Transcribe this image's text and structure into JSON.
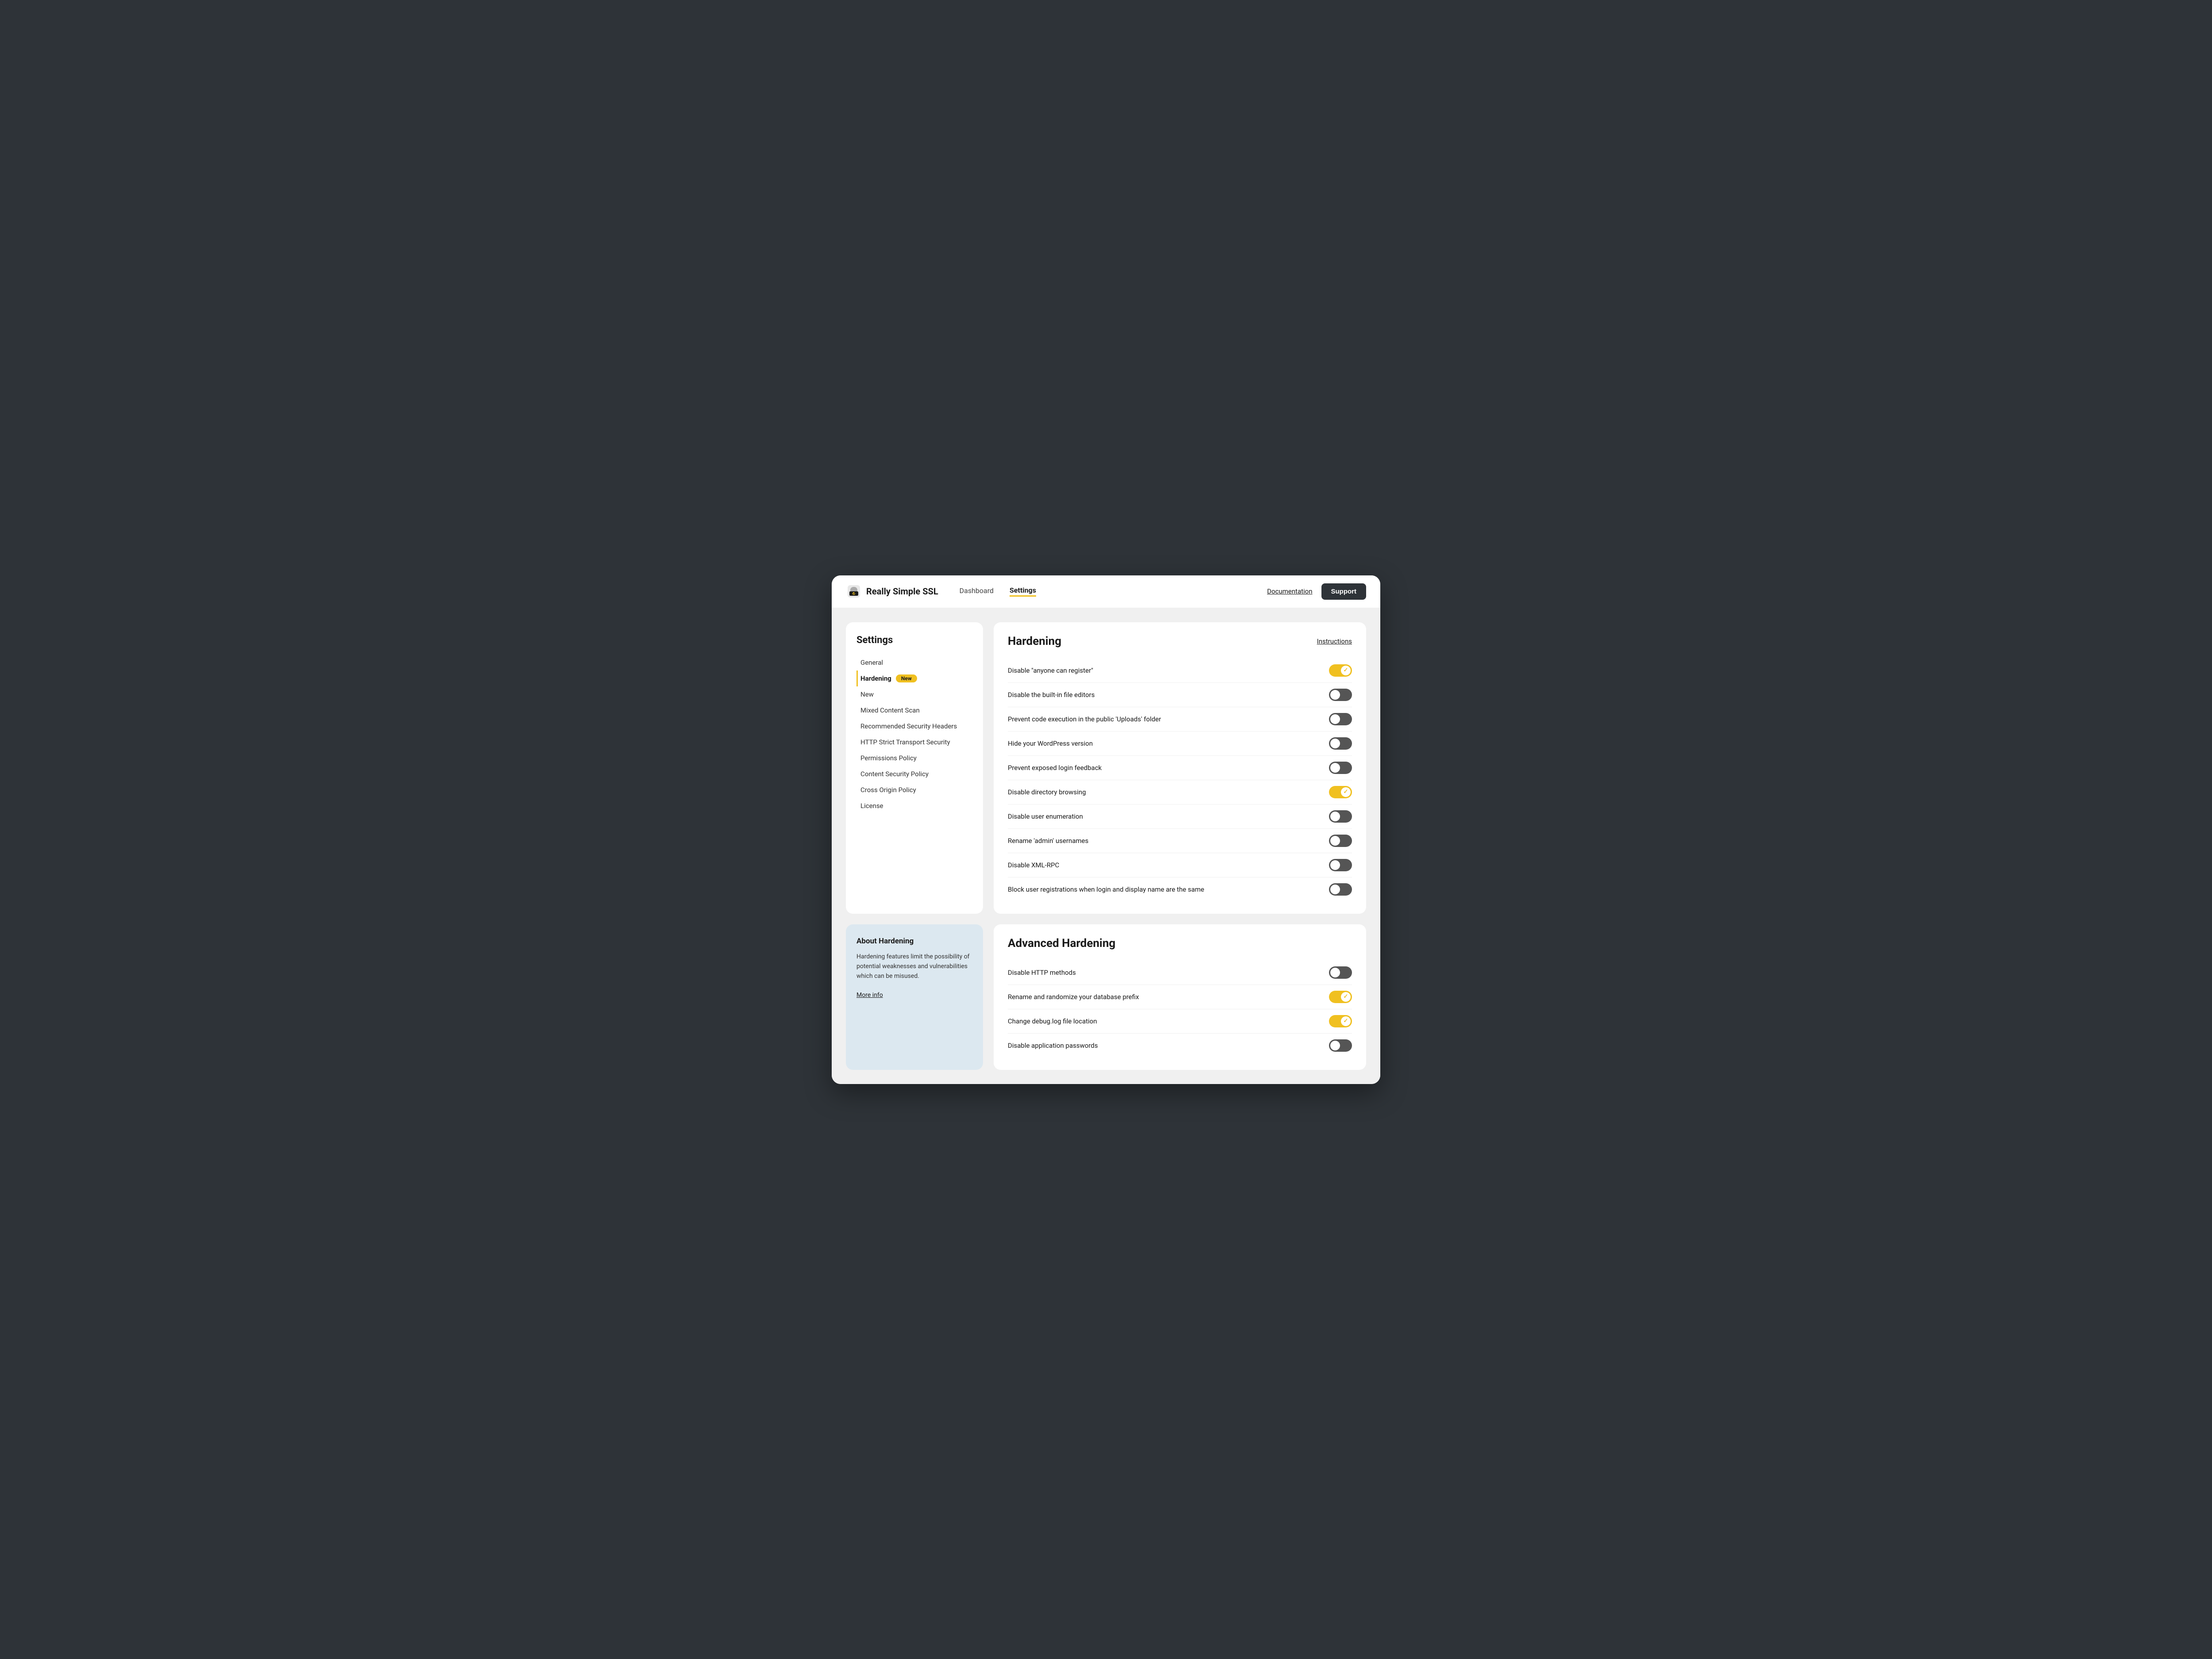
{
  "header": {
    "logo_text": "Really Simple SSL",
    "nav": [
      {
        "label": "Dashboard",
        "active": false
      },
      {
        "label": "Settings",
        "active": true
      }
    ],
    "documentation_label": "Documentation",
    "support_label": "Support"
  },
  "sidebar": {
    "title": "Settings",
    "menu_items": [
      {
        "label": "General",
        "active": false,
        "badge": null
      },
      {
        "label": "Hardening",
        "active": true,
        "badge": "New"
      },
      {
        "label": "New",
        "active": false,
        "badge": null
      },
      {
        "label": "Mixed Content Scan",
        "active": false,
        "badge": null
      },
      {
        "label": "Recommended Security Headers",
        "active": false,
        "badge": null
      },
      {
        "label": "HTTP Strict Transport Security",
        "active": false,
        "badge": null
      },
      {
        "label": "Permissions Policy",
        "active": false,
        "badge": null
      },
      {
        "label": "Content Security Policy",
        "active": false,
        "badge": null
      },
      {
        "label": "Cross Origin Policy",
        "active": false,
        "badge": null
      },
      {
        "label": "License",
        "active": false,
        "badge": null
      }
    ]
  },
  "about": {
    "title": "About Hardening",
    "text": "Hardening features limit the possibility of potential weaknesses and vulnerabilities which can be misused.",
    "more_info_label": "More info"
  },
  "hardening": {
    "title": "Hardening",
    "instructions_label": "Instructions",
    "settings": [
      {
        "label": "Disable \"anyone can register\"",
        "state": "on"
      },
      {
        "label": "Disable the built-in file editors",
        "state": "off"
      },
      {
        "label": "Prevent code execution in the public 'Uploads' folder",
        "state": "off"
      },
      {
        "label": "Hide your WordPress version",
        "state": "off"
      },
      {
        "label": "Prevent exposed login feedback",
        "state": "off"
      },
      {
        "label": "Disable directory browsing",
        "state": "on"
      },
      {
        "label": "Disable user enumeration",
        "state": "off"
      },
      {
        "label": "Rename 'admin' usernames",
        "state": "off"
      },
      {
        "label": "Disable XML-RPC",
        "state": "off"
      },
      {
        "label": "Block user registrations when login and display name are the same",
        "state": "off"
      }
    ]
  },
  "advanced_hardening": {
    "title": "Advanced Hardening",
    "settings": [
      {
        "label": "Disable HTTP methods",
        "state": "off"
      },
      {
        "label": "Rename and randomize your database prefix",
        "state": "on"
      },
      {
        "label": "Change debug.log file location",
        "state": "on"
      },
      {
        "label": "Disable application passwords",
        "state": "off"
      }
    ]
  }
}
